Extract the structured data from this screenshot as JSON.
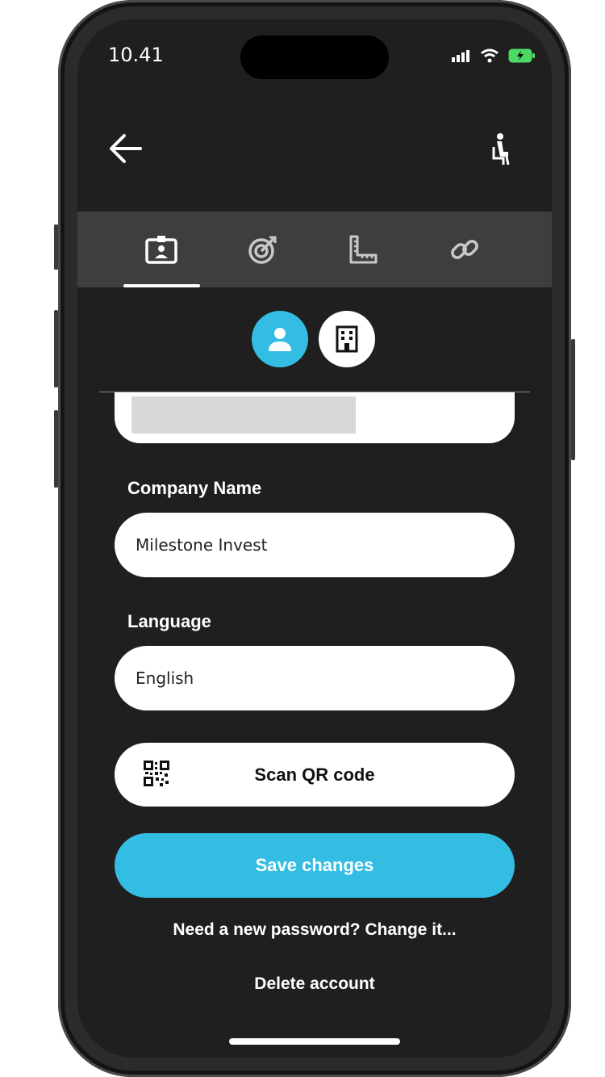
{
  "status_bar": {
    "time": "10.41"
  },
  "header": {
    "back_icon": "arrow-left-icon",
    "action_icon": "seated-person-icon"
  },
  "tabs": [
    {
      "icon": "id-badge-icon",
      "active": true
    },
    {
      "icon": "target-icon",
      "active": false
    },
    {
      "icon": "ruler-icon",
      "active": false
    },
    {
      "icon": "link-icon",
      "active": false
    }
  ],
  "account_type": {
    "person_icon": "person-icon",
    "company_icon": "building-icon",
    "selected": "person"
  },
  "form": {
    "company_name_label": "Company Name",
    "company_name_value": "Milestone Invest",
    "language_label": "Language",
    "language_value": "English"
  },
  "actions": {
    "scan_label": "Scan QR code",
    "save_label": "Save changes",
    "password_link": "Need a new password? Change it...",
    "delete_link": "Delete account"
  },
  "colors": {
    "accent": "#33bde2",
    "background": "#1f1f1f",
    "tabbar": "#3e3e3e"
  }
}
